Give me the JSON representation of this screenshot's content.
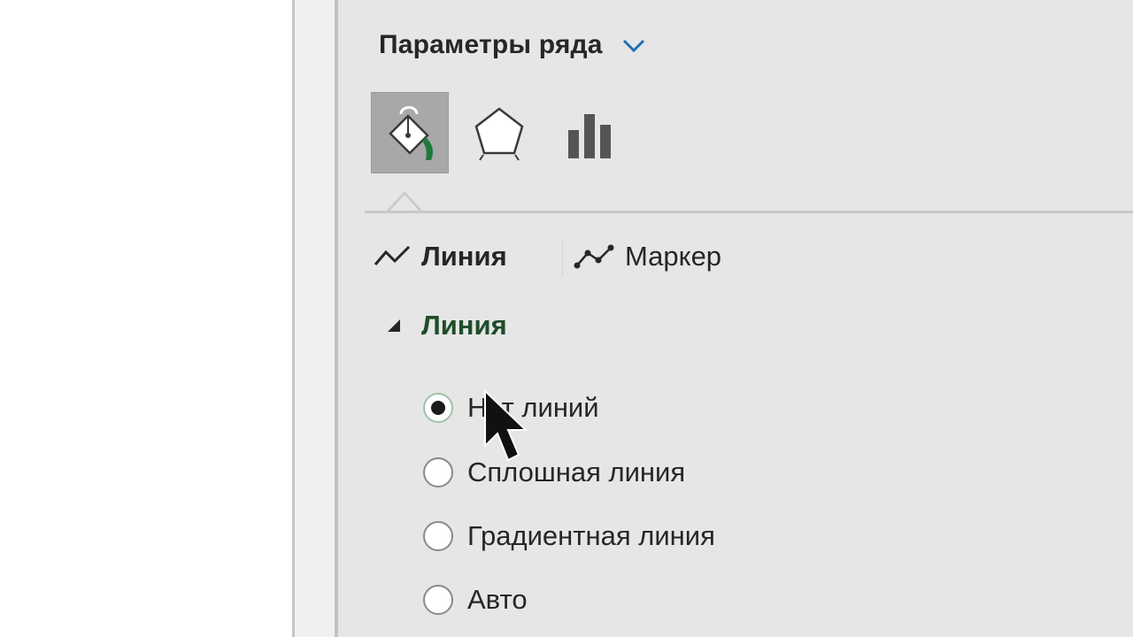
{
  "pane": {
    "title": "Параметры ряда",
    "title_icon": "chevron-down-icon",
    "category_tabs": [
      {
        "icon": "fill-bucket-icon",
        "active": true
      },
      {
        "icon": "pentagon-icon",
        "active": false
      },
      {
        "icon": "bar-chart-icon",
        "active": false
      }
    ],
    "subtabs": [
      {
        "label": "Линия",
        "icon": "line-icon",
        "active": true
      },
      {
        "label": "Маркер",
        "icon": "marker-line-icon",
        "active": false
      }
    ],
    "section": {
      "label": "Линия",
      "expanded": true,
      "options": [
        {
          "label": "Нет линий",
          "checked": true
        },
        {
          "label": "Сплошная линия",
          "checked": false
        },
        {
          "label": "Градиентная линия",
          "checked": false
        },
        {
          "label": "Авто",
          "checked": false
        }
      ]
    }
  },
  "colors": {
    "pane_bg": "#e6e6e6",
    "active_tab_bg": "#a8a8a8",
    "section_label": "#1e4d2b",
    "chevron": "#1f6fb2"
  }
}
